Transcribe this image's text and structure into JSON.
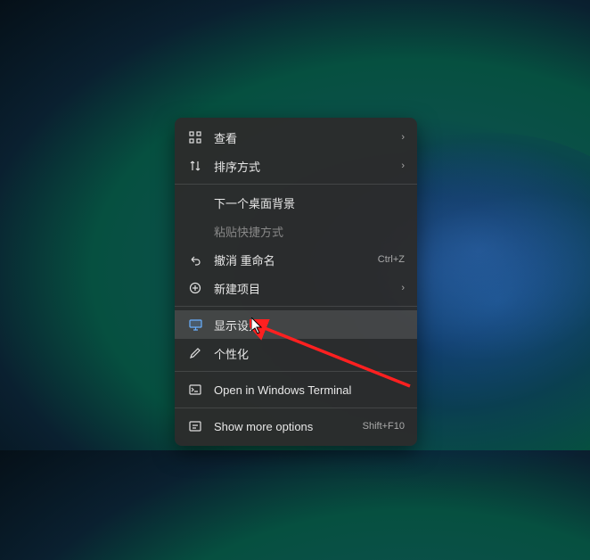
{
  "menu": {
    "items": [
      {
        "label": "查看",
        "has_submenu": true
      },
      {
        "label": "排序方式",
        "has_submenu": true
      },
      {
        "label": "下一个桌面背景"
      },
      {
        "label": "粘贴快捷方式",
        "disabled": true
      },
      {
        "label": "撤消 重命名",
        "shortcut": "Ctrl+Z"
      },
      {
        "label": "新建项目",
        "has_submenu": true
      },
      {
        "label": "显示设置",
        "highlighted": true
      },
      {
        "label": "个性化"
      },
      {
        "label": "Open in Windows Terminal"
      },
      {
        "label": "Show more options",
        "shortcut": "Shift+F10"
      }
    ]
  }
}
